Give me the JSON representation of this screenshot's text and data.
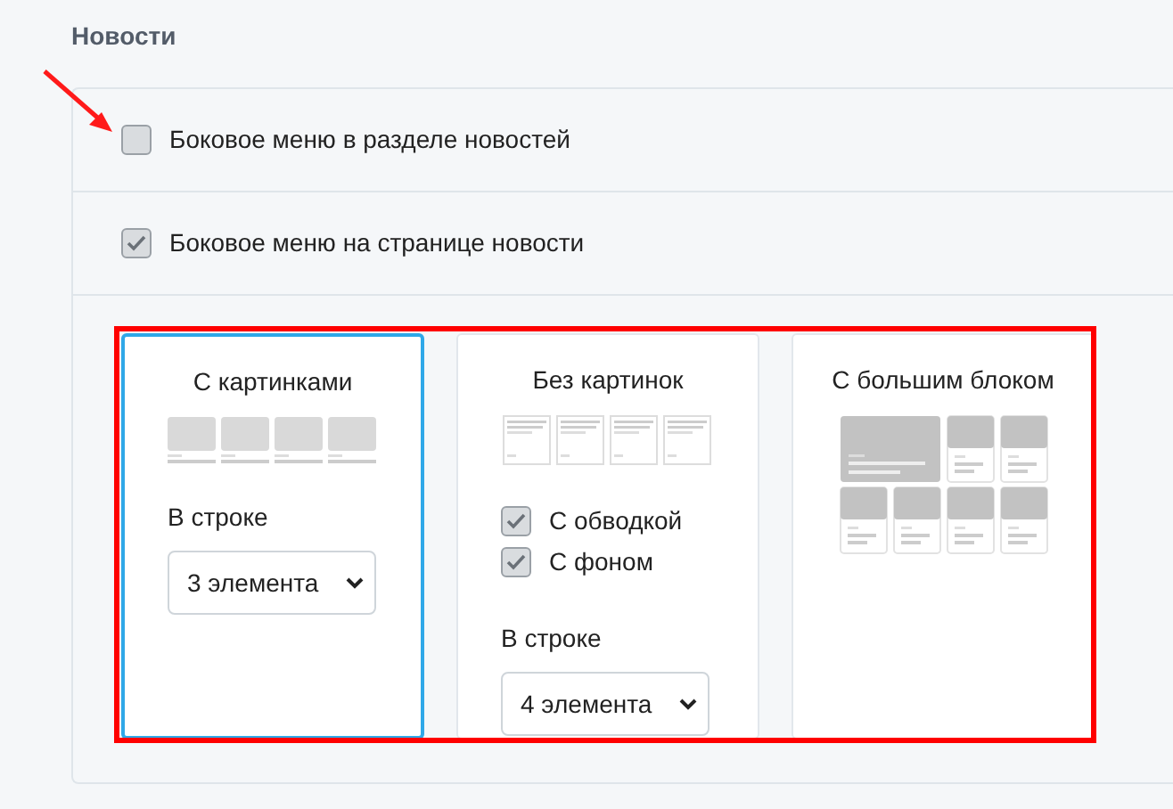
{
  "section_title": "Новости",
  "options": [
    {
      "label": "Боковое меню в разделе новостей",
      "checked": false
    },
    {
      "label": "Боковое меню на странице новости",
      "checked": true
    }
  ],
  "layouts": [
    {
      "kind": "images",
      "title": "С картинками",
      "selected": true,
      "per_row_label": "В строке",
      "per_row_value": "3 элемента"
    },
    {
      "kind": "text",
      "title": "Без картинок",
      "selected": false,
      "checkboxes": [
        {
          "label": "С обводкой",
          "checked": true
        },
        {
          "label": "С фоном",
          "checked": true
        }
      ],
      "per_row_label": "В строке",
      "per_row_value": "4 элемента"
    },
    {
      "kind": "big",
      "title": "С большим блоком",
      "selected": false
    }
  ]
}
